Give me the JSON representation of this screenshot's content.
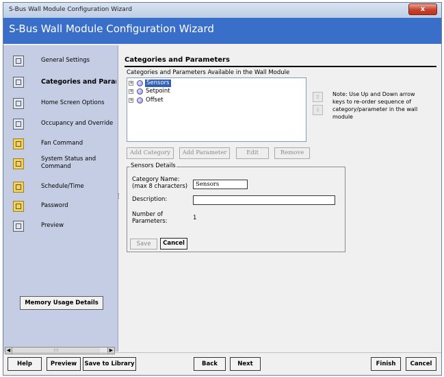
{
  "window": {
    "title": "S-Bus Wall Module Configuration Wizard",
    "close_glyph": "x"
  },
  "banner": {
    "title": "S-Bus Wall Module Configuration Wizard"
  },
  "sidebar": {
    "items": [
      {
        "label": "General Settings",
        "icon": "settings-icon",
        "selected": false
      },
      {
        "label": "Categories and Parameters",
        "icon": "categories-icon",
        "selected": true
      },
      {
        "label": "Home Screen Options",
        "icon": "home-screen-icon",
        "selected": false
      },
      {
        "label": "Occupancy and Override",
        "icon": "occupancy-icon",
        "selected": false
      },
      {
        "label": "Fan Command",
        "icon": "fan-icon",
        "selected": false
      },
      {
        "label": "System Status and Command",
        "icon": "system-status-icon",
        "selected": false
      },
      {
        "label": "Schedule/Time",
        "icon": "schedule-icon",
        "selected": false
      },
      {
        "label": "Password",
        "icon": "password-icon",
        "selected": false
      },
      {
        "label": "Preview",
        "icon": "preview-icon",
        "selected": false
      }
    ],
    "memory_button": "Memory Usage Details",
    "scroll": {
      "left": "◀",
      "right": "▶",
      "thumb": "!!!"
    }
  },
  "main": {
    "title": "Categories and Parameters",
    "available_label": "Categories and Parameters Available in the Wall Module",
    "tree": [
      {
        "label": "Sensors",
        "selected": true,
        "expander": "+"
      },
      {
        "label": "Setpoint",
        "selected": false,
        "expander": "+"
      },
      {
        "label": "Offset",
        "selected": false,
        "expander": "+"
      }
    ],
    "move_up": "⇧",
    "move_down": "⇩",
    "note": "Note: Use Up and Down arrow keys to re-order sequence of category/parameter in the wall module",
    "buttons": {
      "add_category": "Add Category",
      "add_parameter": "Add Parameter",
      "edit": "Edit",
      "remove": "Remove"
    },
    "details": {
      "legend": "Sensors Details",
      "category_name_label": "Category Name:",
      "category_name_hint": "(max 8 characters)",
      "category_name_value": "Sensors",
      "description_label": "Description:",
      "description_value": "",
      "num_params_label": "Number of Parameters:",
      "num_params_value": "1",
      "save": "Save",
      "cancel": "Cancel"
    }
  },
  "footer": {
    "help": "Help",
    "preview": "Preview",
    "save_library": "Save to Library",
    "back": "Back",
    "next": "Next",
    "finish": "Finish",
    "cancel": "Cancel"
  }
}
